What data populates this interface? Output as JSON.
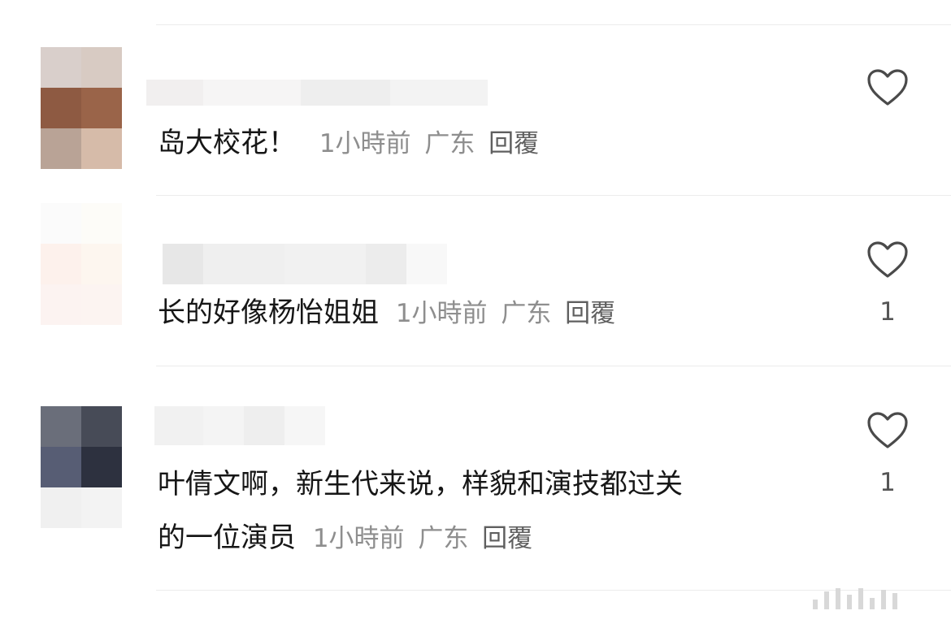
{
  "comments": [
    {
      "text": "岛大校花！",
      "time": "1小時前",
      "location": "广东",
      "reply_label": "回覆",
      "likes": ""
    },
    {
      "text": "长的好像杨怡姐姐",
      "time": "1小時前",
      "location": "广东",
      "reply_label": "回覆",
      "likes": "1"
    },
    {
      "text_line1": "叶倩文啊，新生代来说，样貌和演技都过关",
      "text_line2": "的一位演员",
      "time": "1小時前",
      "location": "广东",
      "reply_label": "回覆",
      "likes": "1"
    }
  ],
  "icons": {
    "like": "heart-outline-icon"
  },
  "colors": {
    "text": "#161616",
    "meta": "#8e8e8e",
    "divider": "#ececec",
    "heart": "#4a4a4a"
  }
}
